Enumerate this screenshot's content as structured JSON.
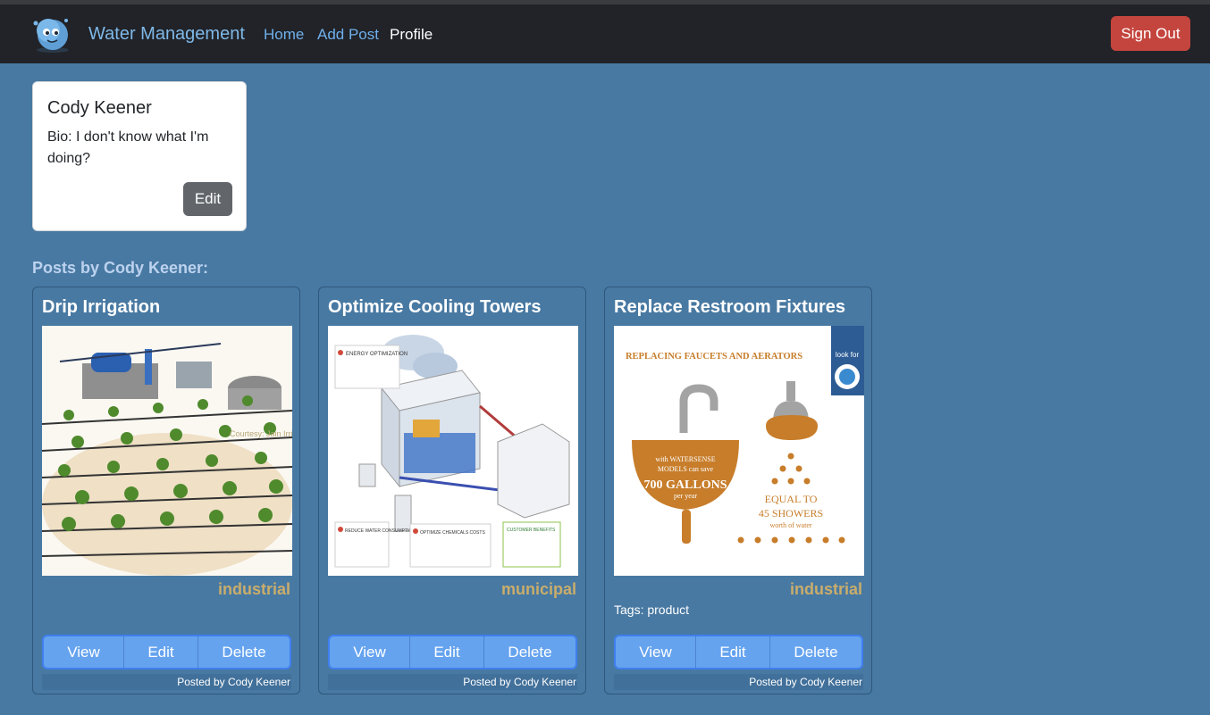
{
  "navbar": {
    "brand": "Water Management",
    "links": [
      {
        "label": "Home"
      },
      {
        "label": "Add Post"
      },
      {
        "label": "Profile"
      }
    ],
    "sign_out": "Sign Out"
  },
  "profile": {
    "name": "Cody Keener",
    "bio": "Bio: I don't know what I'm doing?",
    "edit_label": "Edit"
  },
  "posts_heading": "Posts by Cody Keener:",
  "posts": [
    {
      "title": "Drip Irrigation",
      "category": "industrial",
      "tags": "",
      "view": "View",
      "edit": "Edit",
      "delete": "Delete",
      "footer": "Posted by Cody Keener",
      "image_texts": {
        "watermark": "Courtesy: Jain Irrigation"
      }
    },
    {
      "title": "Optimize Cooling Towers",
      "category": "municipal",
      "tags": "",
      "view": "View",
      "edit": "Edit",
      "delete": "Delete",
      "footer": "Posted by Cody Keener",
      "image_texts": {
        "box1": "ENERGY OPTIMIZATION",
        "box2": "REDUCE WATER CONSUMPTION",
        "box3": "OPTIMIZE CHEMICALS COSTS",
        "box4": "CUSTOMER BENEFITS"
      }
    },
    {
      "title": "Replace Restroom Fixtures",
      "category": "industrial",
      "tags": "Tags: product",
      "view": "View",
      "edit": "Edit",
      "delete": "Delete",
      "footer": "Posted by Cody Keener",
      "image_texts": {
        "headline": "REPLACING FAUCETS AND AERATORS",
        "look_for": "look for",
        "sink1": "with WATERSENSE",
        "sink2": "MODELS can save",
        "sink3": "700 GALLONS",
        "sink4": "per year",
        "equal1": "EQUAL TO",
        "equal2": "45 SHOWERS",
        "equal3": "worth of water"
      }
    }
  ],
  "colors": {
    "background": "#4879a2",
    "navbar": "#212328",
    "sign_out": "#c4453e",
    "button_group": "#65a3ef",
    "category": "#c9ad6b"
  }
}
